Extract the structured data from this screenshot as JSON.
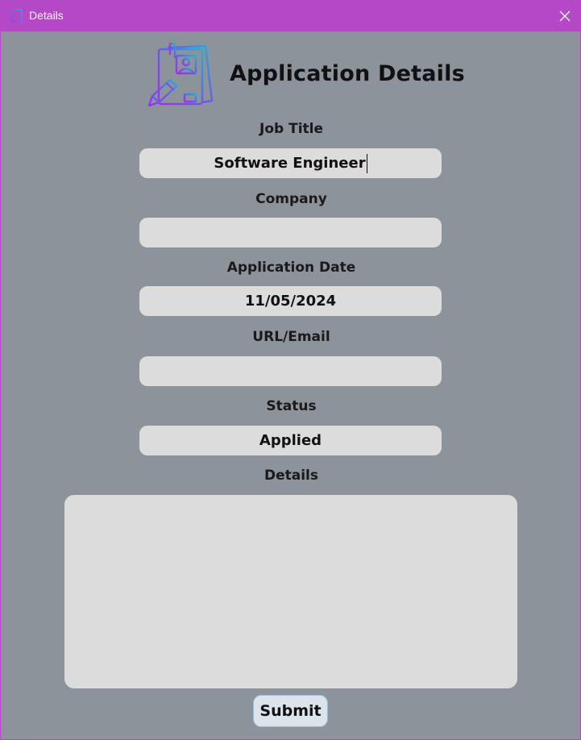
{
  "window": {
    "title": "Details",
    "titlebar_color": "#b548c6",
    "background_color": "#8c939a"
  },
  "header": {
    "title": "Application Details",
    "icon": "resume-document-icon"
  },
  "form": {
    "job_title": {
      "label": "Job Title",
      "value": "Software Engineer"
    },
    "company": {
      "label": "Company",
      "value": ""
    },
    "application_date": {
      "label": "Application Date",
      "value": "11/05/2024"
    },
    "url_email": {
      "label": "URL/Email",
      "value": ""
    },
    "status": {
      "label": "Status",
      "value": "Applied"
    },
    "details": {
      "label": "Details",
      "value": ""
    }
  },
  "submit_label": "Submit"
}
